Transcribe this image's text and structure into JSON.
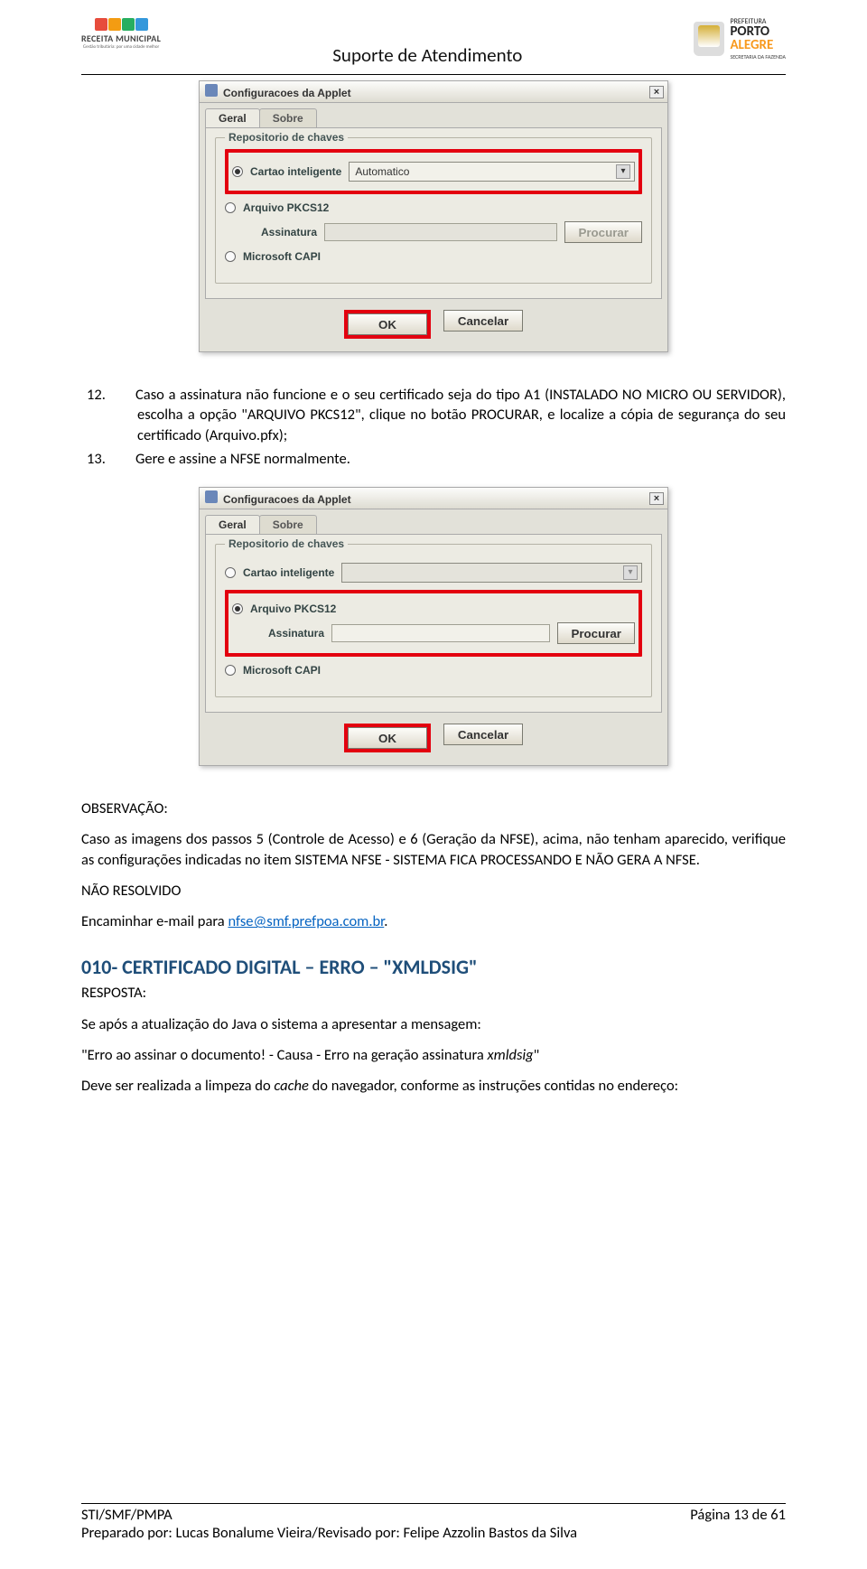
{
  "header": {
    "title": "Suporte de Atendimento",
    "logo_left_line1": "RECEITA MUNICIPAL",
    "logo_left_line2": "Gestão tributária: por uma cidade melhor",
    "logo_right_pre": "PREFEITURA",
    "logo_right_l1": "PORTO",
    "logo_right_l2": "ALEGRE",
    "logo_right_sec": "SECRETARIA DA FAZENDA"
  },
  "dialog": {
    "title": "Configuracoes da Applet",
    "close": "×",
    "tabs": {
      "geral": "Geral",
      "sobre": "Sobre"
    },
    "group_label": "Repositorio de chaves",
    "opt_cartao": "Cartao inteligente",
    "select_auto": "Automatico",
    "opt_pkcs": "Arquivo PKCS12",
    "lbl_assinatura": "Assinatura",
    "btn_procurar": "Procurar",
    "opt_capi": "Microsoft CAPI",
    "btn_ok": "OK",
    "btn_cancel": "Cancelar"
  },
  "text": {
    "li12_num": "12.",
    "li12": "Caso a assinatura não funcione e o seu certificado seja do tipo A1 (INSTALADO NO MICRO OU SERVIDOR), escolha a opção \"ARQUIVO PKCS12\", clique no botão PROCURAR, e localize a cópia de segurança do seu certificado (Arquivo.pfx);",
    "li13_num": "13.",
    "li13": "Gere e assine a NFSE normalmente.",
    "obs_title": "OBSERVAÇÃO:",
    "obs_body": "Caso as imagens dos passos 5 (Controle de Acesso) e 6 (Geração da NFSE), acima, não tenham aparecido, verifique as configurações indicadas no item SISTEMA NFSE - SISTEMA FICA PROCESSANDO E NÃO GERA A NFSE.",
    "nao_resolvido": "NÃO RESOLVIDO",
    "encaminhar_pre": "Encaminhar e-mail para ",
    "email": "nfse@smf.prefpoa.com.br",
    "encaminhar_post": ".",
    "h2": "010- CERTIFICADO DIGITAL – ERRO – \"XMLDSIG\"",
    "resposta": "RESPOSTA:",
    "p_java": "Se após a atualização do Java o sistema a apresentar a mensagem:",
    "p_erro_pre": "\"Erro ao assinar o documento! - Causa - Erro na geração assinatura ",
    "p_erro_ital": "xmldsig",
    "p_erro_post": "\"",
    "p_cache_pre": "Deve ser realizada a limpeza do ",
    "p_cache_ital": "cache",
    "p_cache_post": " do navegador, conforme as instruções contidas no endereço:"
  },
  "footer": {
    "left": "STI/SMF/PMPA",
    "right": "Página 13 de 61",
    "prepared": "Preparado por: Lucas Bonalume Vieira/Revisado por: Felipe Azzolin Bastos da Silva"
  }
}
